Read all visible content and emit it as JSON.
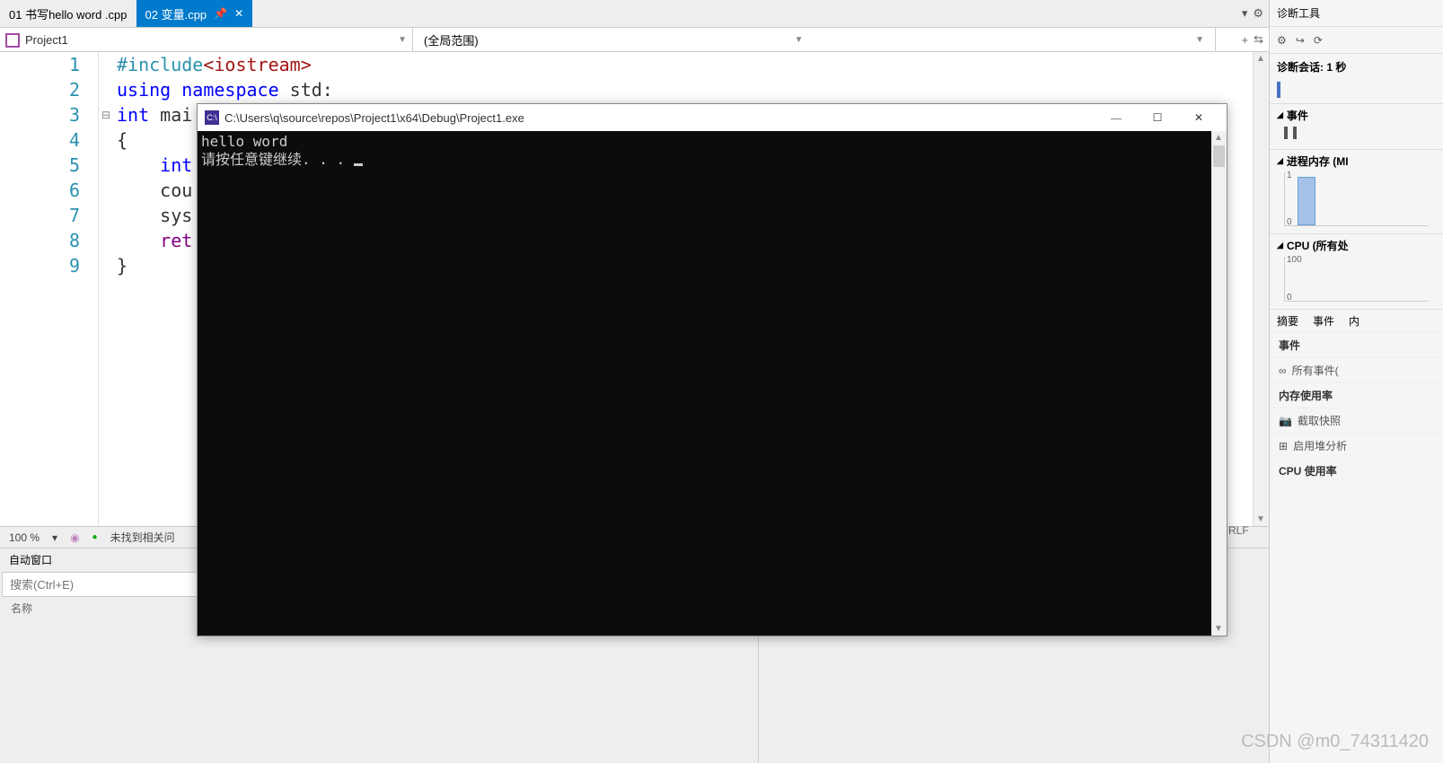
{
  "tabs": [
    {
      "label": "01 书写hello word .cpp"
    },
    {
      "label": "02 变量.cpp",
      "pin": "📌",
      "close": "✕"
    }
  ],
  "tabTools": {
    "dropdown": "▾",
    "gear": "⚙"
  },
  "scope": {
    "project": "Project1",
    "global": "(全局范围)",
    "plus": "+",
    "split": "⇆"
  },
  "code": {
    "lineNumbers": [
      "1",
      "2",
      "3",
      "4",
      "5",
      "6",
      "7",
      "8",
      "9"
    ],
    "fold": [
      "",
      "",
      "⊟",
      "",
      "",
      "",
      "",
      "",
      ""
    ],
    "l1a": "#include",
    "l1b": "<iostream>",
    "l2a": "using",
    "l2b": " ",
    "l2c": "namespace",
    "l2d": " std:",
    "l3a": "int",
    "l3b": " mai",
    "l4": "{",
    "l5": "    int",
    "l6": "    cou",
    "l7": "    sys",
    "l8": "    ret",
    "l9": "}"
  },
  "editorStatus": {
    "zoom": "100 %",
    "noIssues": "未找到相关问",
    "lineEnding": "RLF"
  },
  "bottomPanel": {
    "title": "自动窗口",
    "searchPlaceholder": "搜索(Ctrl+E)",
    "colName": "名称"
  },
  "console": {
    "icon": "C:\\",
    "title": "C:\\Users\\q\\source\\repos\\Project1\\x64\\Debug\\Project1.exe",
    "line1": "hello word",
    "line2": "请按任意键继续. . . ",
    "btnMin": "—",
    "btnMax": "☐",
    "btnClose": "✕"
  },
  "diag": {
    "title": "诊断工具",
    "session": "诊断会话: 1 秒",
    "events": "事件",
    "memory": "进程内存 (MI",
    "memTop": "1",
    "memBot": "0",
    "cpu": "CPU (所有处",
    "cpuTop": "100",
    "cpuBot": "0",
    "tabSummary": "摘要",
    "tabEvents": "事件",
    "tabMore": "内",
    "secEvents": "事件",
    "allEvents": "所有事件(",
    "secMemUsage": "内存使用率",
    "snapshot": "截取快照",
    "heap": "启用堆分析",
    "secCpuUsage": "CPU 使用率",
    "gear": "⚙",
    "arrow": "↪",
    "refresh": "⟳",
    "tri": "◢"
  },
  "watermark": "CSDN @m0_74311420"
}
